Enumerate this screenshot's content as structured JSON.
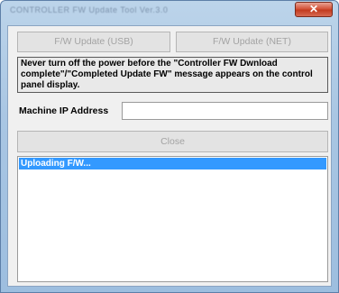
{
  "window": {
    "title": "CONTROLLER FW Update Tool Ver.3.0",
    "close_glyph": "✕"
  },
  "buttons": {
    "usb_label": "F/W Update (USB)",
    "net_label": "F/W Update (NET)",
    "close_label": "Close"
  },
  "warning": {
    "text": "Never turn off the power before the \"Controller FW Dwnload complete\"/\"Completed Update FW\" message appears on the control panel display."
  },
  "ip": {
    "label": "Machine IP Address",
    "value": ""
  },
  "log": {
    "items": [
      "Uploading F/W..."
    ]
  },
  "colors": {
    "selection": "#3399ff",
    "titlebar": "#a9c6e3",
    "close_button": "#c23b1f"
  }
}
